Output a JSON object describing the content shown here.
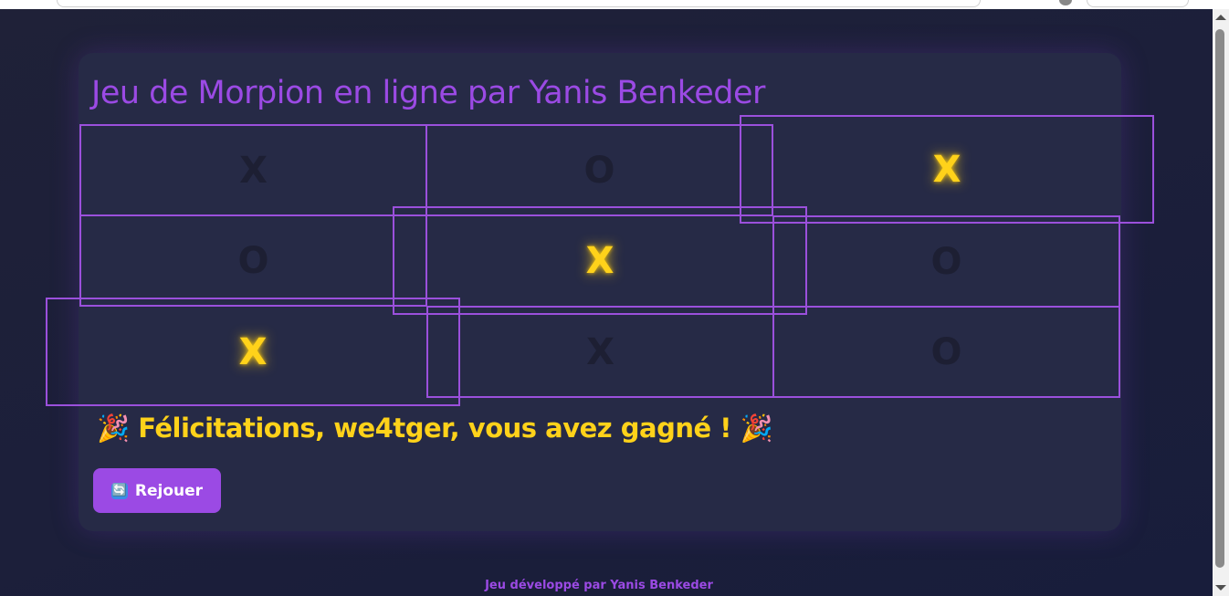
{
  "page": {
    "title": "Jeu de Morpion en ligne par Yanis Benkeder"
  },
  "board": {
    "cells": [
      {
        "mark": "X",
        "winning": false
      },
      {
        "mark": "O",
        "winning": false
      },
      {
        "mark": "X",
        "winning": true
      },
      {
        "mark": "O",
        "winning": false
      },
      {
        "mark": "X",
        "winning": true
      },
      {
        "mark": "O",
        "winning": false
      },
      {
        "mark": "X",
        "winning": true
      },
      {
        "mark": "X",
        "winning": false
      },
      {
        "mark": "O",
        "winning": false
      }
    ]
  },
  "status": {
    "emoji_left": "🎉",
    "message": "Félicitations, we4tger, vous avez gagné !",
    "emoji_right": "🎉"
  },
  "replay_button": {
    "icon": "🔄",
    "label": "Rejouer"
  },
  "footer": {
    "text": "Jeu développé par Yanis Benkeder"
  },
  "colors": {
    "accent": "#9b4ae4",
    "win": "#ffd21a",
    "card": "#262a46",
    "background": "#1c1f3a"
  },
  "icons": {
    "replay": "refresh-icon",
    "celebration": "party-popper-icon"
  }
}
